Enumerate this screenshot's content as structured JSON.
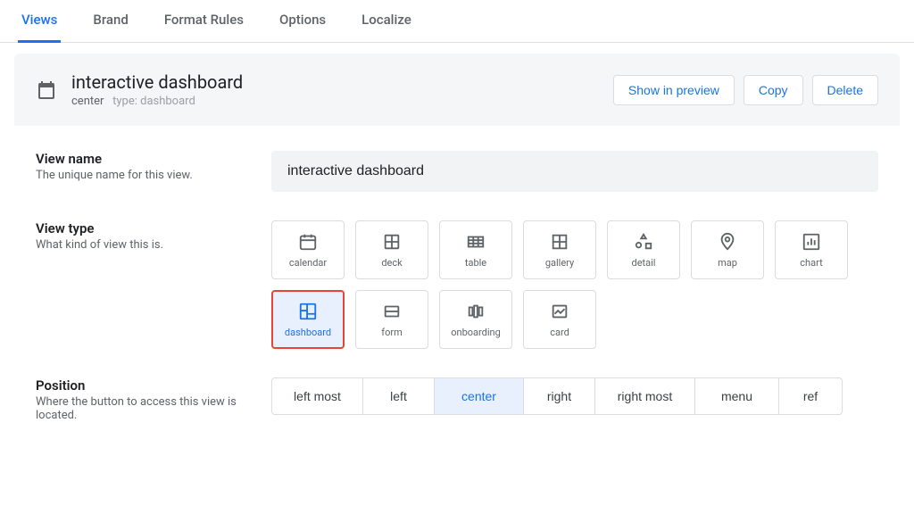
{
  "tabs": {
    "items": [
      {
        "label": "Views",
        "active": true
      },
      {
        "label": "Brand",
        "active": false
      },
      {
        "label": "Format Rules",
        "active": false
      },
      {
        "label": "Options",
        "active": false
      },
      {
        "label": "Localize",
        "active": false
      }
    ]
  },
  "header": {
    "title": "interactive dashboard",
    "position": "center",
    "type_prefix": "type:",
    "type_value": "dashboard",
    "actions": {
      "show_in_preview": "Show in preview",
      "copy": "Copy",
      "delete": "Delete"
    }
  },
  "fields": {
    "view_name": {
      "label": "View name",
      "desc": "The unique name for this view.",
      "value": "interactive dashboard"
    },
    "view_type": {
      "label": "View type",
      "desc": "What kind of view this is.",
      "options": [
        {
          "key": "calendar",
          "label": "calendar",
          "icon": "calendar-icon",
          "selected": false
        },
        {
          "key": "deck",
          "label": "deck",
          "icon": "deck-icon",
          "selected": false
        },
        {
          "key": "table",
          "label": "table",
          "icon": "table-icon",
          "selected": false
        },
        {
          "key": "gallery",
          "label": "gallery",
          "icon": "gallery-icon",
          "selected": false
        },
        {
          "key": "detail",
          "label": "detail",
          "icon": "detail-icon",
          "selected": false
        },
        {
          "key": "map",
          "label": "map",
          "icon": "map-pin-icon",
          "selected": false
        },
        {
          "key": "chart",
          "label": "chart",
          "icon": "chart-icon",
          "selected": false
        },
        {
          "key": "dashboard",
          "label": "dashboard",
          "icon": "dashboard-icon",
          "selected": true
        },
        {
          "key": "form",
          "label": "form",
          "icon": "form-icon",
          "selected": false
        },
        {
          "key": "onboarding",
          "label": "onboarding",
          "icon": "onboarding-icon",
          "selected": false
        },
        {
          "key": "card",
          "label": "card",
          "icon": "card-icon",
          "selected": false
        }
      ]
    },
    "position": {
      "label": "Position",
      "desc": "Where the button to access this view is located.",
      "options": [
        {
          "key": "left_most",
          "label": "left most",
          "selected": false
        },
        {
          "key": "left",
          "label": "left",
          "selected": false
        },
        {
          "key": "center",
          "label": "center",
          "selected": true
        },
        {
          "key": "right",
          "label": "right",
          "selected": false
        },
        {
          "key": "right_most",
          "label": "right most",
          "selected": false
        },
        {
          "key": "menu",
          "label": "menu",
          "selected": false
        },
        {
          "key": "ref",
          "label": "ref",
          "selected": false
        }
      ]
    }
  }
}
